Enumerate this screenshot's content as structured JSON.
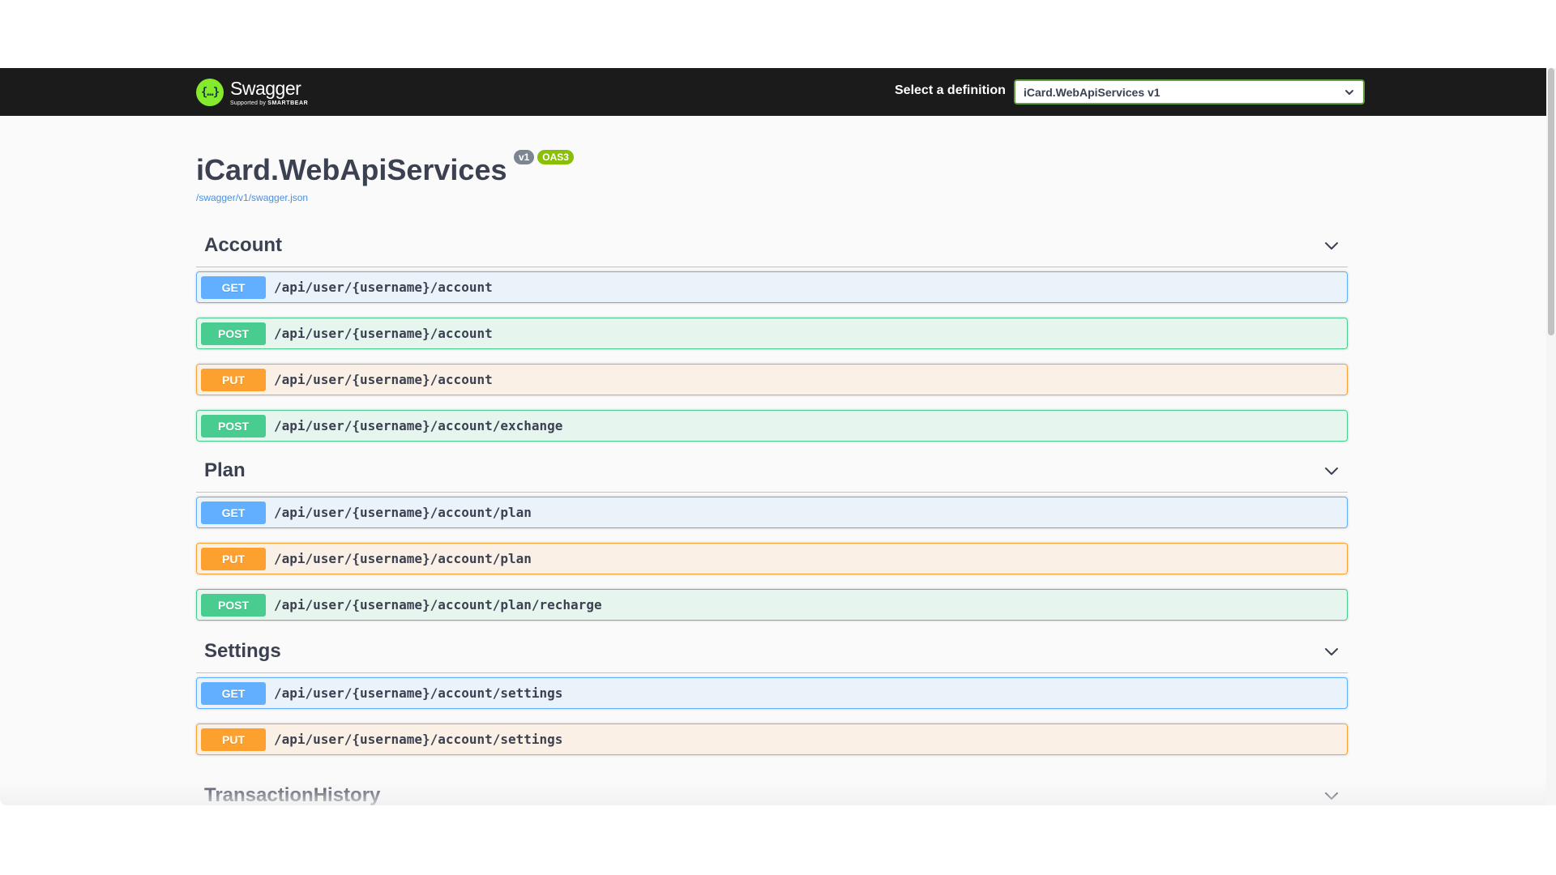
{
  "topbar": {
    "logo_name": "Swagger",
    "logo_sub_prefix": "Supported by",
    "logo_sub_brand": "SMARTBEAR",
    "definition_label": "Select a definition",
    "definition_selected": "iCard.WebApiServices v1"
  },
  "info": {
    "title": "iCard.WebApiServices",
    "version_badge": "v1",
    "oas_badge": "OAS3",
    "spec_link": "/swagger/v1/swagger.json"
  },
  "tags": [
    {
      "name": "Account",
      "operations": [
        {
          "method": "GET",
          "path": "/api/user/{username}/account"
        },
        {
          "method": "POST",
          "path": "/api/user/{username}/account"
        },
        {
          "method": "PUT",
          "path": "/api/user/{username}/account"
        },
        {
          "method": "POST",
          "path": "/api/user/{username}/account/exchange"
        }
      ]
    },
    {
      "name": "Plan",
      "operations": [
        {
          "method": "GET",
          "path": "/api/user/{username}/account/plan"
        },
        {
          "method": "PUT",
          "path": "/api/user/{username}/account/plan"
        },
        {
          "method": "POST",
          "path": "/api/user/{username}/account/plan/recharge"
        }
      ]
    },
    {
      "name": "Settings",
      "operations": [
        {
          "method": "GET",
          "path": "/api/user/{username}/account/settings"
        },
        {
          "method": "PUT",
          "path": "/api/user/{username}/account/settings"
        }
      ]
    },
    {
      "name": "TransactionHistory",
      "operations": []
    }
  ],
  "colors": {
    "GET": "#61affe",
    "POST": "#49cc90",
    "PUT": "#fca130",
    "topbar": "#1b1b1b",
    "logo": "#85ea2d"
  }
}
